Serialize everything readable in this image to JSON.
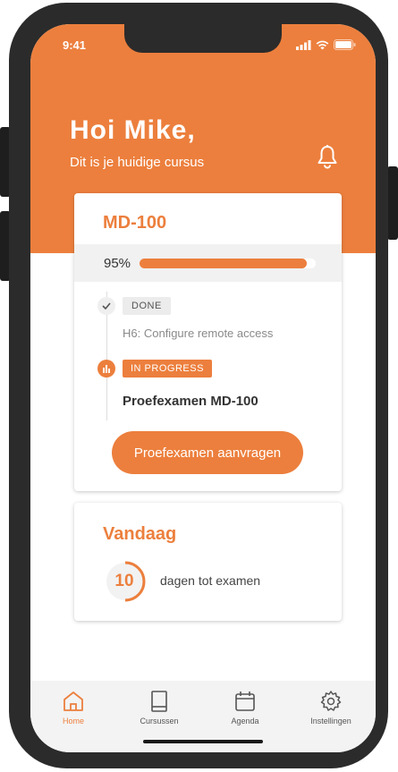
{
  "status_bar": {
    "time": "9:41"
  },
  "header": {
    "greeting": "Hoi Mike,",
    "subtitle": "Dit is je huidige cursus"
  },
  "course": {
    "title": "MD-100",
    "progress_label": "95%",
    "progress_value": 0.95,
    "done_tag": "DONE",
    "done_item": "H6: Configure remote access",
    "in_progress_tag": "IN PROGRESS",
    "in_progress_item": "Proefexamen MD-100",
    "button_label": "Proefexamen aanvragen"
  },
  "today": {
    "title": "Vandaag",
    "days_count": "10",
    "days_label": "dagen tot examen"
  },
  "tabs": [
    {
      "label": "Home",
      "icon": "home-icon",
      "active": true
    },
    {
      "label": "Cursussen",
      "icon": "book-icon",
      "active": false
    },
    {
      "label": "Agenda",
      "icon": "calendar-icon",
      "active": false
    },
    {
      "label": "Instellingen",
      "icon": "gear-icon",
      "active": false
    }
  ],
  "colors": {
    "accent": "#ec7f3d",
    "frame": "#2b2b2b"
  }
}
